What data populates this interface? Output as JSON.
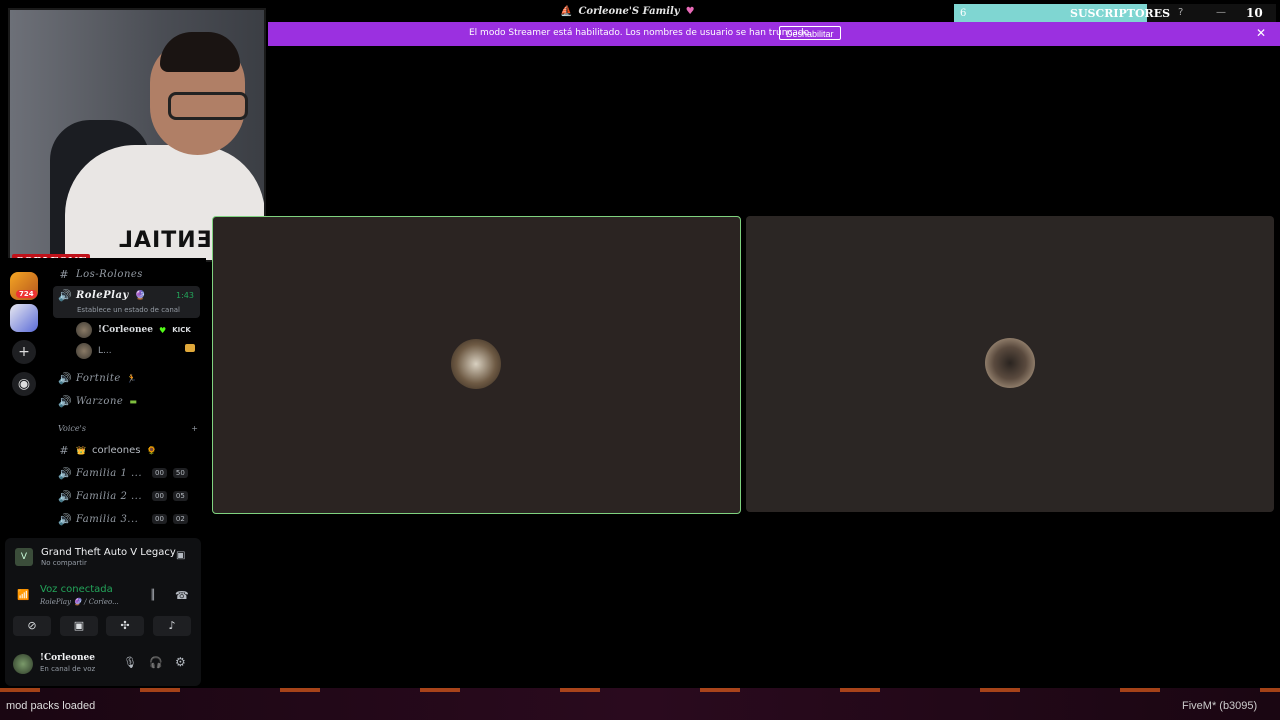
{
  "titlebar": {
    "title": "Corleone'S Family",
    "subs_left": "6",
    "subs_label": "SUSCRIPTORES",
    "subs_right": "10",
    "subs_progress": 0.6,
    "help": "?",
    "minimize": "—",
    "maximize": "□"
  },
  "banner": {
    "text": "El modo Streamer está habilitado. Los nombres de usuario se han truncado.",
    "button": "Deshabilitar",
    "close": "✕",
    "color": "#9b30e0"
  },
  "webcam": {
    "shirt_text": "SSENTIAL",
    "logo_text": "CORLEONE"
  },
  "rail": {
    "badge": "724"
  },
  "channels": {
    "items": [
      {
        "icon": "#",
        "name": "Los-Rolones"
      },
      {
        "icon": "🔊",
        "name": "RolePlay",
        "time": "1:43",
        "status": "Establece un estado de canal"
      },
      {
        "icon": "🔊",
        "name": "Fortnite"
      },
      {
        "icon": "🔊",
        "name": "Warzone"
      }
    ],
    "voice_users": [
      {
        "name": "!Corleonee",
        "tag": "KICK"
      },
      {
        "name": "L..."
      }
    ],
    "category": "Voice's",
    "voice_channels": [
      {
        "icon": "#",
        "name": "corleones"
      },
      {
        "icon": "🔊",
        "name": "Familia 1 ...",
        "a": "00",
        "b": "50"
      },
      {
        "icon": "🔊",
        "name": "Familia 2 ...",
        "a": "00",
        "b": "05"
      },
      {
        "icon": "🔊",
        "name": "Familia 3...",
        "a": "00",
        "b": "02"
      }
    ]
  },
  "panel": {
    "activity_title": "Grand Theft Auto V Legacy",
    "activity_sub": "No compartir",
    "voice_status": "Voz conectada",
    "voice_channel": "RolePlay 🔮 / Corleo...",
    "user_name": "!Corleonee",
    "user_status": "En canal de voz",
    "accent": "#23a55a"
  },
  "status": {
    "left": "mod packs loaded",
    "right": "FiveM* (b3095)"
  }
}
